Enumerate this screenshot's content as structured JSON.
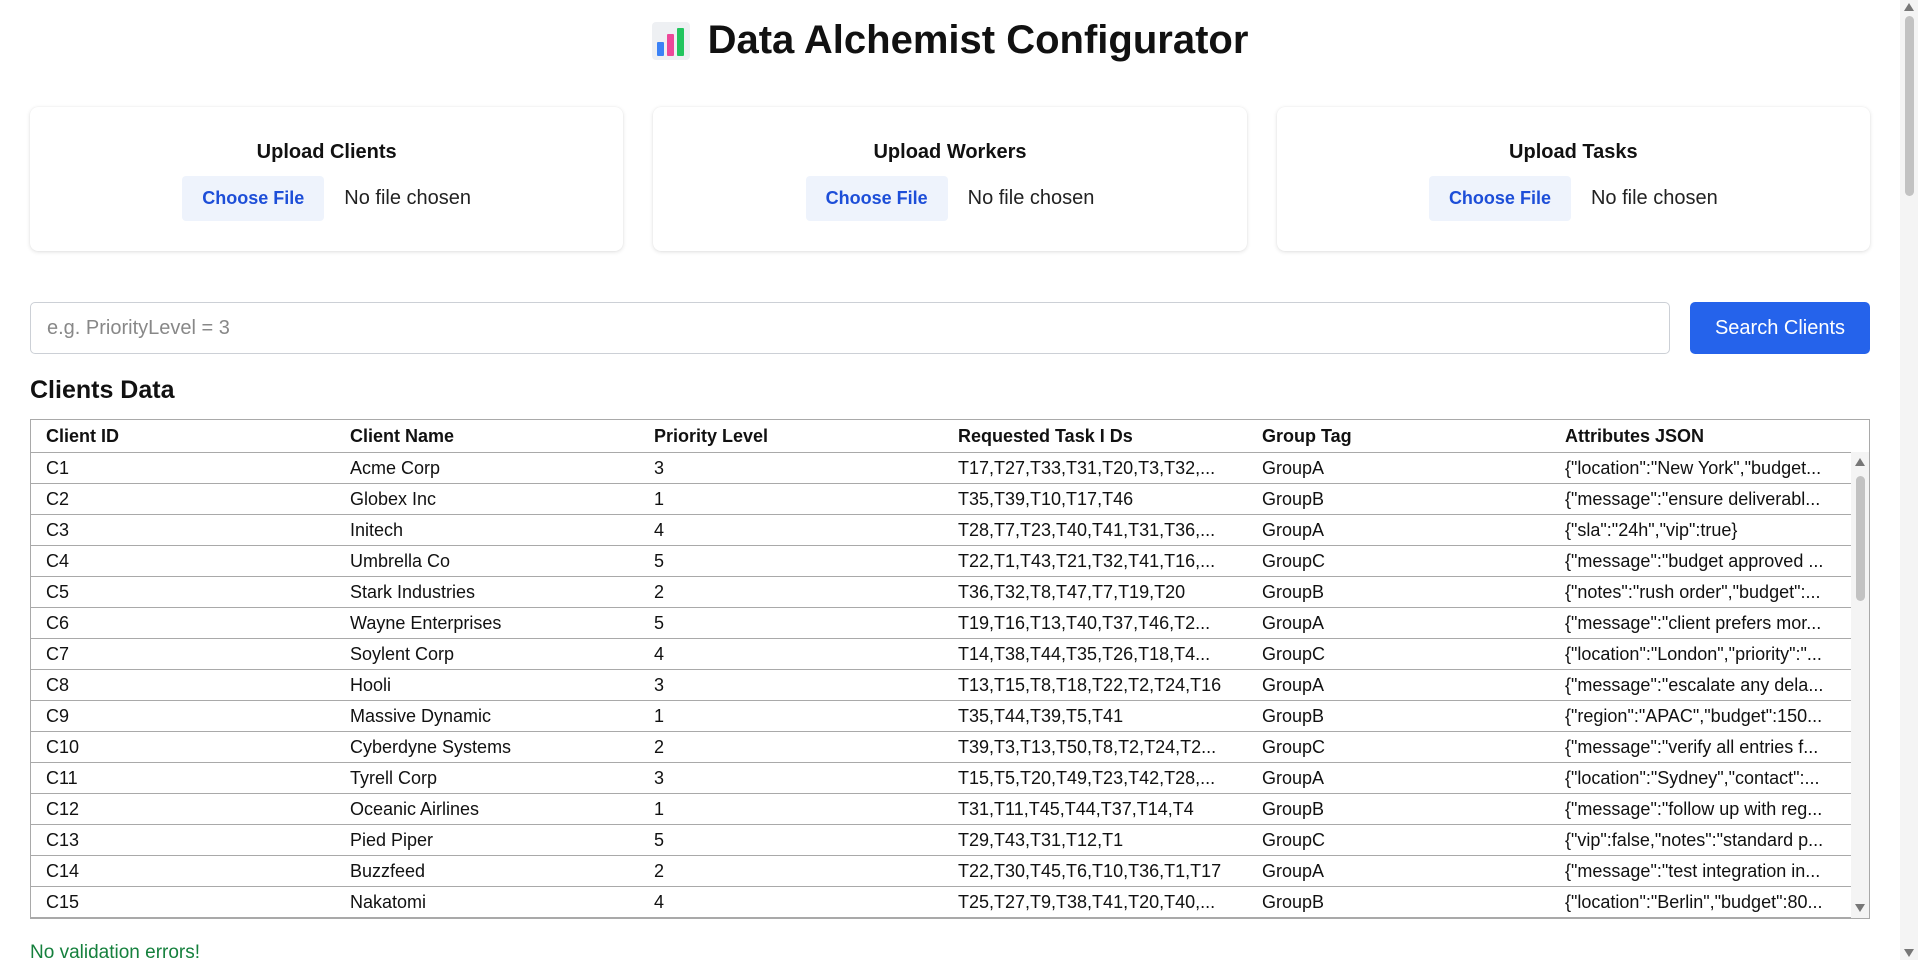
{
  "header": {
    "icon": "bar-chart-icon",
    "title": "Data Alchemist Configurator"
  },
  "uploads": [
    {
      "title": "Upload Clients",
      "button": "Choose File",
      "status": "No file chosen"
    },
    {
      "title": "Upload Workers",
      "button": "Choose File",
      "status": "No file chosen"
    },
    {
      "title": "Upload Tasks",
      "button": "Choose File",
      "status": "No file chosen"
    }
  ],
  "search": {
    "placeholder": "e.g. PriorityLevel = 3",
    "button": "Search Clients"
  },
  "clients": {
    "title": "Clients Data",
    "columns": [
      "Client ID",
      "Client Name",
      "Priority Level",
      "Requested Task I Ds",
      "Group Tag",
      "Attributes JSON"
    ],
    "rows": [
      [
        "C1",
        "Acme Corp",
        "3",
        "T17,T27,T33,T31,T20,T3,T32,...",
        "GroupA",
        "{\"location\":\"New York\",\"budget..."
      ],
      [
        "C2",
        "Globex Inc",
        "1",
        "T35,T39,T10,T17,T46",
        "GroupB",
        "{\"message\":\"ensure deliverabl..."
      ],
      [
        "C3",
        "Initech",
        "4",
        "T28,T7,T23,T40,T41,T31,T36,...",
        "GroupA",
        "{\"sla\":\"24h\",\"vip\":true}"
      ],
      [
        "C4",
        "Umbrella Co",
        "5",
        "T22,T1,T43,T21,T32,T41,T16,...",
        "GroupC",
        "{\"message\":\"budget approved ..."
      ],
      [
        "C5",
        "Stark Industries",
        "2",
        "T36,T32,T8,T47,T7,T19,T20",
        "GroupB",
        "{\"notes\":\"rush order\",\"budget\":..."
      ],
      [
        "C6",
        "Wayne Enterprises",
        "5",
        "T19,T16,T13,T40,T37,T46,T2...",
        "GroupA",
        "{\"message\":\"client prefers mor..."
      ],
      [
        "C7",
        "Soylent Corp",
        "4",
        "T14,T38,T44,T35,T26,T18,T4...",
        "GroupC",
        "{\"location\":\"London\",\"priority\":\"..."
      ],
      [
        "C8",
        "Hooli",
        "3",
        "T13,T15,T8,T18,T22,T2,T24,T16",
        "GroupA",
        "{\"message\":\"escalate any dela..."
      ],
      [
        "C9",
        "Massive Dynamic",
        "1",
        "T35,T44,T39,T5,T41",
        "GroupB",
        "{\"region\":\"APAC\",\"budget\":150..."
      ],
      [
        "C10",
        "Cyberdyne Systems",
        "2",
        "T39,T3,T13,T50,T8,T2,T24,T2...",
        "GroupC",
        "{\"message\":\"verify all entries f..."
      ],
      [
        "C11",
        "Tyrell Corp",
        "3",
        "T15,T5,T20,T49,T23,T42,T28,...",
        "GroupA",
        "{\"location\":\"Sydney\",\"contact\":..."
      ],
      [
        "C12",
        "Oceanic Airlines",
        "1",
        "T31,T11,T45,T44,T37,T14,T4",
        "GroupB",
        "{\"message\":\"follow up with reg..."
      ],
      [
        "C13",
        "Pied Piper",
        "5",
        "T29,T43,T31,T12,T1",
        "GroupC",
        "{\"vip\":false,\"notes\":\"standard p..."
      ],
      [
        "C14",
        "Buzzfeed",
        "2",
        "T22,T30,T45,T6,T10,T36,T1,T17",
        "GroupA",
        "{\"message\":\"test integration in..."
      ],
      [
        "C15",
        "Nakatomi",
        "4",
        "T25,T27,T9,T38,T41,T20,T40,...",
        "GroupB",
        "{\"location\":\"Berlin\",\"budget\":80..."
      ]
    ]
  },
  "validation": {
    "message": "No validation errors!",
    "color": "#15803d"
  },
  "colors": {
    "accent": "#2563eb",
    "choose_button_text": "#1d4ed8"
  }
}
